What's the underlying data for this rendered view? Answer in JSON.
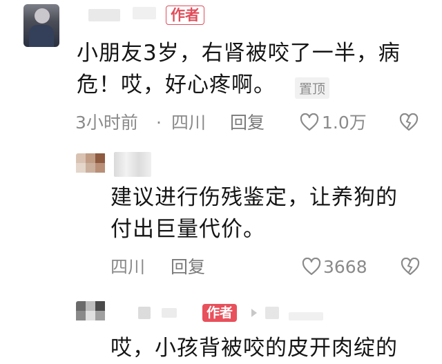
{
  "comments": [
    {
      "author_badge": "作者",
      "text_line1": "小朋友3岁，右肾被咬了一半，病",
      "text_line2": "危！哎，好心疼啊。",
      "pinned_label": "置顶",
      "time": "3小时前",
      "separator": "·",
      "location": "四川",
      "reply_label": "回复",
      "like_count": "1.0万"
    },
    {
      "text_line1": "建议进行伤残鉴定，让养狗的",
      "text_line2": "付出巨量代价。",
      "location": "四川",
      "reply_label": "回复",
      "like_count": "3668"
    },
    {
      "author_badge": "作者",
      "text_line1": "哎，小孩背被咬的皮开肉绽的"
    }
  ]
}
